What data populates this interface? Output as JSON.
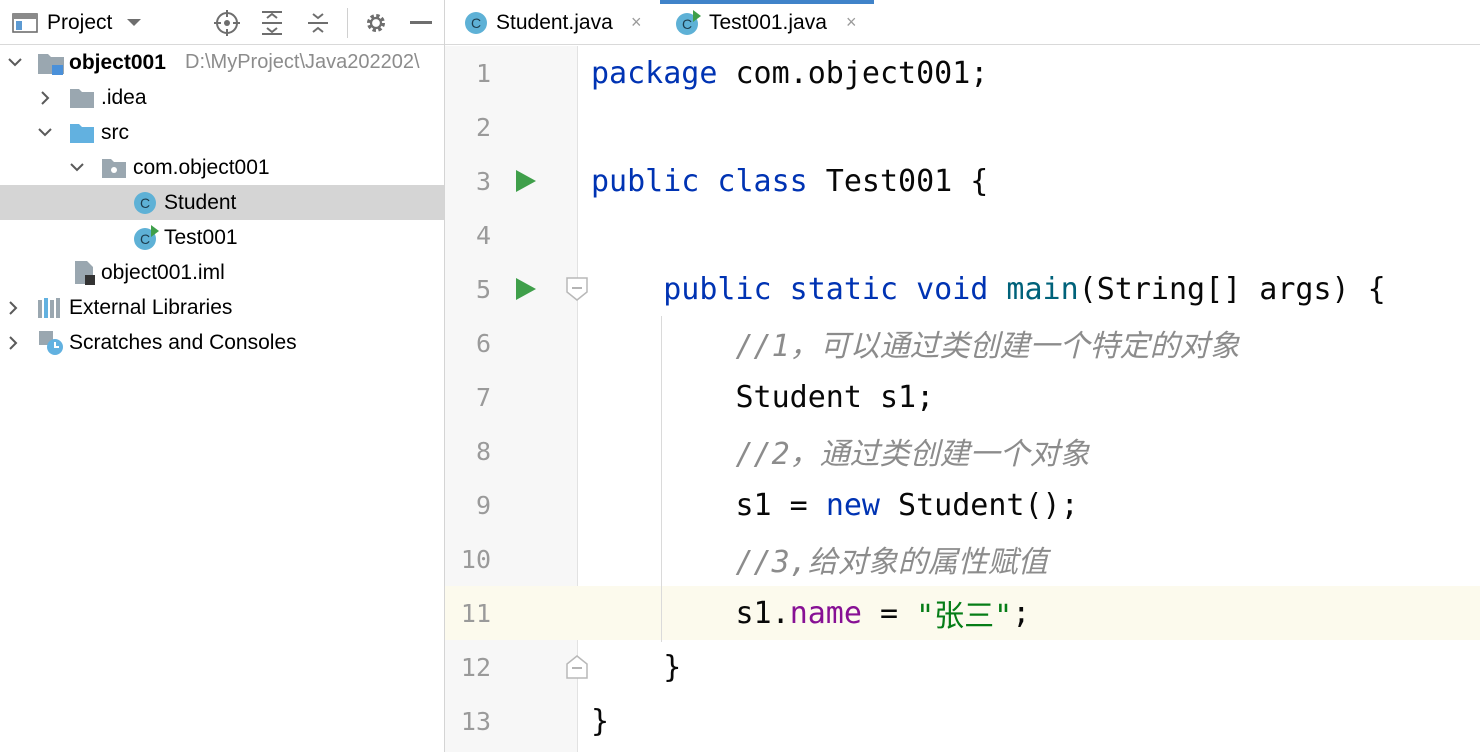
{
  "project_panel": {
    "title": "Project",
    "header_icons": [
      "locate-icon",
      "expand-all-icon",
      "collapse-all-icon",
      "gear-icon",
      "minimize-icon"
    ],
    "tree": [
      {
        "label": "object001",
        "path": "D:\\MyProject\\Java202202\\",
        "icon": "module-icon",
        "expanded": true,
        "bold": true
      },
      {
        "label": ".idea",
        "icon": "folder-icon",
        "expanded": false
      },
      {
        "label": "src",
        "icon": "source-folder-icon",
        "expanded": true
      },
      {
        "label": "com.object001",
        "icon": "package-icon",
        "expanded": true
      },
      {
        "label": "Student",
        "icon": "class-icon",
        "selected": true
      },
      {
        "label": "Test001",
        "icon": "runnable-class-icon"
      },
      {
        "label": "object001.iml",
        "icon": "iml-file-icon"
      },
      {
        "label": "External Libraries",
        "icon": "libraries-icon",
        "expanded": false
      },
      {
        "label": "Scratches and Consoles",
        "icon": "scratches-icon",
        "expanded": false
      }
    ]
  },
  "tabs": [
    {
      "label": "Student.java",
      "icon": "class-icon",
      "active": false,
      "close": "×"
    },
    {
      "label": "Test001.java",
      "icon": "runnable-class-icon",
      "active": true,
      "close": "×"
    }
  ],
  "editor": {
    "current_line": 11,
    "lines": [
      {
        "n": "1",
        "tokens": [
          [
            "kw",
            "package"
          ],
          [
            "txt",
            " com.object001;"
          ]
        ]
      },
      {
        "n": "2",
        "tokens": []
      },
      {
        "n": "3",
        "tokens": [
          [
            "kw",
            "public class"
          ],
          [
            "txt",
            " Test001 {"
          ]
        ],
        "run": true
      },
      {
        "n": "4",
        "tokens": []
      },
      {
        "n": "5",
        "tokens": [
          [
            "txt",
            "    "
          ],
          [
            "kw",
            "public static void"
          ],
          [
            "txt",
            " "
          ],
          [
            "fn",
            "main"
          ],
          [
            "txt",
            "(String[] args) {"
          ]
        ],
        "run": true,
        "fold": "open"
      },
      {
        "n": "6",
        "tokens": [
          [
            "txt",
            "        "
          ],
          [
            "cmt",
            "//1，可以通过类创建一个特定的对象"
          ]
        ]
      },
      {
        "n": "7",
        "tokens": [
          [
            "txt",
            "        Student s1;"
          ]
        ]
      },
      {
        "n": "8",
        "tokens": [
          [
            "txt",
            "        "
          ],
          [
            "cmt",
            "//2，通过类创建一个对象"
          ]
        ]
      },
      {
        "n": "9",
        "tokens": [
          [
            "txt",
            "        s1 = "
          ],
          [
            "kw",
            "new"
          ],
          [
            "txt",
            " Student();"
          ]
        ]
      },
      {
        "n": "10",
        "tokens": [
          [
            "txt",
            "        "
          ],
          [
            "cmt",
            "//3,给对象的属性赋值"
          ]
        ]
      },
      {
        "n": "11",
        "tokens": [
          [
            "txt",
            "        s1."
          ],
          [
            "fld",
            "name"
          ],
          [
            "txt",
            " = "
          ],
          [
            "str",
            "\"张三\""
          ],
          [
            "txt",
            ";"
          ]
        ]
      },
      {
        "n": "12",
        "tokens": [
          [
            "txt",
            "    }"
          ]
        ],
        "fold": "close"
      },
      {
        "n": "13",
        "tokens": [
          [
            "txt",
            "}"
          ]
        ]
      }
    ]
  },
  "colors": {
    "keyword": "#0033b3",
    "method": "#00627a",
    "field": "#871094",
    "string": "#067d17",
    "comment": "#8c8c8c",
    "selection": "#d5d5d5",
    "current_line": "#fcfaed",
    "run_icon": "#3f9f4a",
    "class_icon": "#5eb1d6",
    "tab_underline": "#4083c9"
  }
}
